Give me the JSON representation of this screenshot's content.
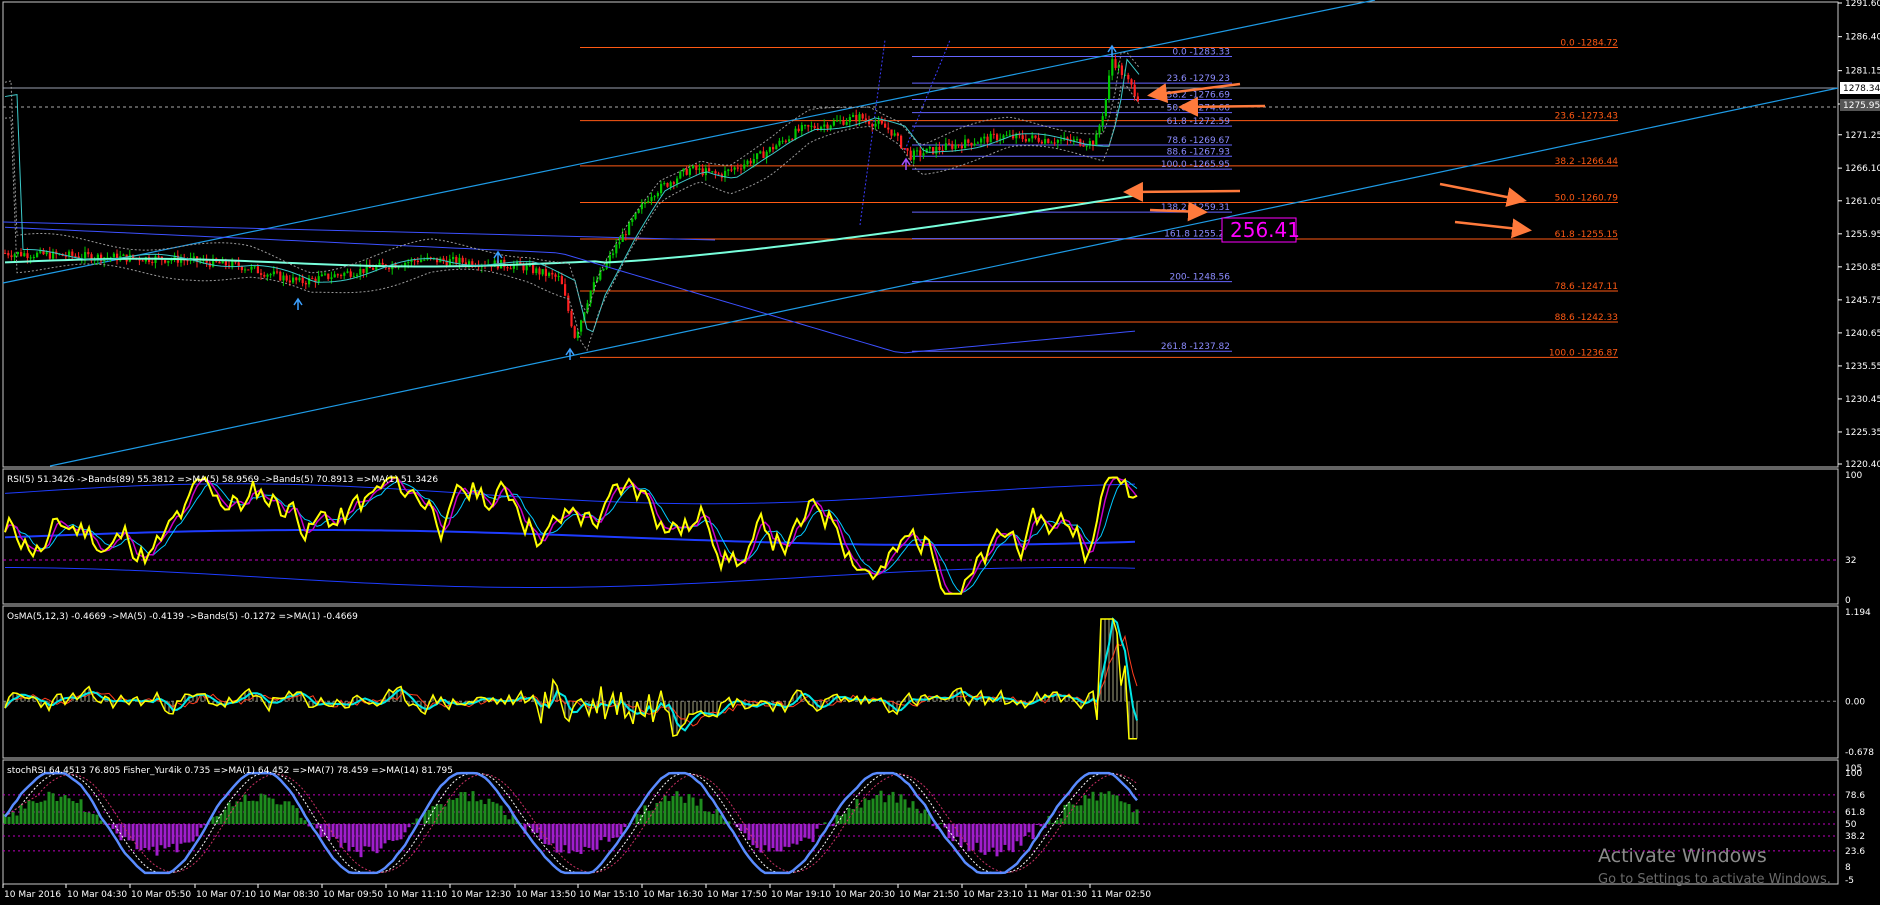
{
  "chart_data": [
    {
      "type": "candlestick",
      "panel": "price",
      "y_axis_ticks": [
        "1291.60",
        "1286.40",
        "1281.15",
        "1276.00",
        "1271.25",
        "1266.10",
        "1261.05",
        "1255.95",
        "1250.85",
        "1245.75",
        "1240.65",
        "1235.55",
        "1230.45",
        "1225.35",
        "1220.40"
      ],
      "current_price_tags": [
        "1278.34",
        "1275.95"
      ],
      "fib_left": [
        {
          "label": "0.0 -1283.33",
          "price": 1283.33
        },
        {
          "label": "23.6 -1279.23",
          "price": 1279.23
        },
        {
          "label": "38.2 -1276.69",
          "price": 1276.69
        },
        {
          "label": "50.0 -1274.66",
          "price": 1274.66
        },
        {
          "label": "61.8 -1272.59",
          "price": 1272.59
        },
        {
          "label": "78.6 -1269.67",
          "price": 1269.67
        },
        {
          "label": "88.6 -1267.93",
          "price": 1267.93
        },
        {
          "label": "100.0 -1265.95",
          "price": 1265.95
        },
        {
          "label": "138.2 -1259.31",
          "price": 1259.31
        },
        {
          "label": "161.8 1255.20",
          "price": 1255.2
        },
        {
          "label": "200- 1248.56",
          "price": 1248.56
        },
        {
          "label": "261.8 -1237.82",
          "price": 1237.82
        }
      ],
      "fib_right": [
        {
          "label": "0.0 -1284.72",
          "price": 1284.72
        },
        {
          "label": "23.6 -1273.43",
          "price": 1273.43
        },
        {
          "label": "38.2 -1266.44",
          "price": 1266.44
        },
        {
          "label": "50.0 -1260.79",
          "price": 1260.79
        },
        {
          "label": "61.8 -1255.15",
          "price": 1255.15
        },
        {
          "label": "78.6 -1247.11",
          "price": 1247.11
        },
        {
          "label": "88.6 -1242.33",
          "price": 1242.33
        },
        {
          "label": "100.0 -1236.87",
          "price": 1236.87
        }
      ],
      "price_box": "256.41",
      "colors": {
        "bull": "#00c800",
        "bear": "#ff2020",
        "fib_left": "#6464ff",
        "fib_right": "#ff5a14",
        "channel": "#1e9be6",
        "ma": "#78ffdc"
      }
    },
    {
      "type": "line",
      "panel": "rsi",
      "title": "RSI(5) 51.3426  ->Bands(89) 55.3812  =>MA(5) 58.9569  ->Bands(5) 70.8913  =>MA(1) 51.3426",
      "y_axis_ticks": [
        "100",
        "32",
        "0"
      ],
      "ylim": [
        0,
        100
      ]
    },
    {
      "type": "line",
      "panel": "osma",
      "title": "OsMA(5,12,3) -0.4669  ->MA(5) -0.4139  ->Bands(5) -0.1272  =>MA(1) -0.4669",
      "y_axis_ticks": [
        "1.194",
        "0.00",
        "-0.678"
      ],
      "ylim": [
        -0.678,
        1.194
      ]
    },
    {
      "type": "bar",
      "panel": "stochrsi",
      "title": "stochRSI 64.4513 76.805  Fisher_Yur4ik  0.735  =>MA(1) 64.452  =>MA(7) 78.459  =>MA(14) 81.795",
      "y_axis_ticks": [
        "105",
        "100",
        "78.6",
        "61.8",
        "50",
        "38.2",
        "23.6",
        "8",
        "-5"
      ]
    }
  ],
  "x_axis_labels": [
    "10 Mar 2016",
    "10 Mar 04:30",
    "10 Mar 05:50",
    "10 Mar 07:10",
    "10 Mar 08:30",
    "10 Mar 09:50",
    "10 Mar 11:10",
    "10 Mar 12:30",
    "10 Mar 13:50",
    "10 Mar 15:10",
    "10 Mar 16:30",
    "10 Mar 17:50",
    "10 Mar 19:10",
    "10 Mar 20:30",
    "10 Mar 21:50",
    "10 Mar 23:10",
    "11 Mar 01:30",
    "11 Mar 02:50"
  ],
  "watermark": {
    "line1": "Activate Windows",
    "line2": "Go to Settings to activate Windows."
  }
}
